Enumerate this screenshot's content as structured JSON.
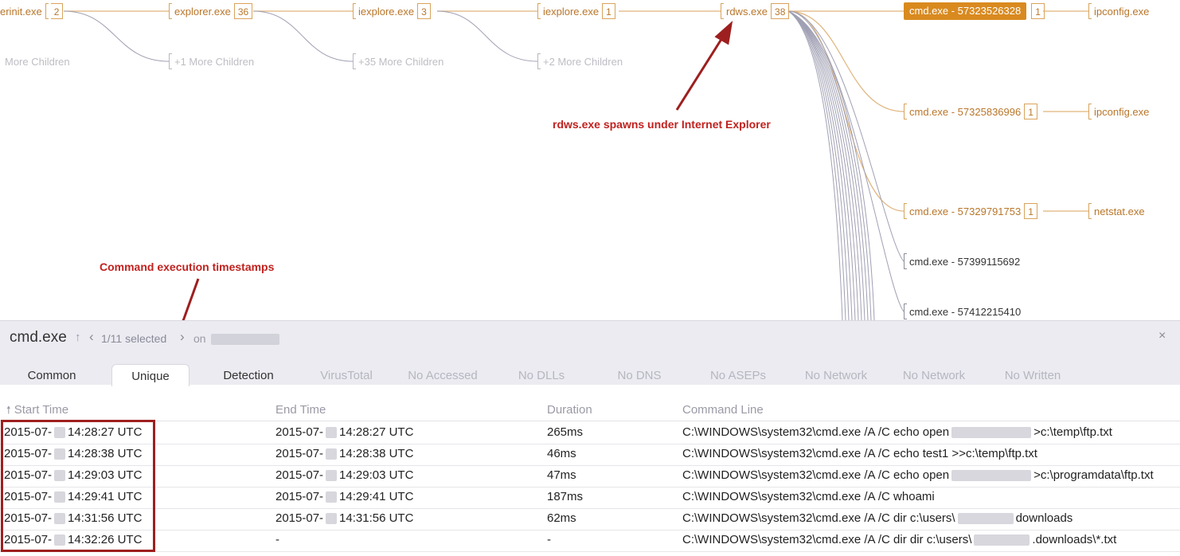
{
  "tree": {
    "nodes": [
      {
        "id": "userinit",
        "name": "erinit.exe",
        "count": "2",
        "style": "orange"
      },
      {
        "id": "explorer",
        "name": "explorer.exe",
        "count": "36",
        "style": "orange"
      },
      {
        "id": "iexplore1",
        "name": "iexplore.exe",
        "count": "3",
        "style": "orange"
      },
      {
        "id": "iexplore2",
        "name": "iexplore.exe",
        "count": "1",
        "style": "orange"
      },
      {
        "id": "rdws",
        "name": "rdws.exe",
        "count": "38",
        "style": "orange"
      },
      {
        "id": "cmd1",
        "name": "cmd.exe - 57323526328",
        "count": "1",
        "style": "selected"
      },
      {
        "id": "ipconfig1",
        "name": "ipconfig.exe",
        "count": "",
        "style": "orange"
      },
      {
        "id": "cmd2",
        "name": "cmd.exe - 57325836996",
        "count": "1",
        "style": "orange"
      },
      {
        "id": "ipconfig2",
        "name": "ipconfig.exe",
        "count": "",
        "style": "orange"
      },
      {
        "id": "cmd3",
        "name": "cmd.exe - 57329791753",
        "count": "1",
        "style": "orange"
      },
      {
        "id": "netstat",
        "name": "netstat.exe",
        "count": "",
        "style": "orange"
      },
      {
        "id": "cmd4",
        "name": "cmd.exe - 57399115692",
        "count": "",
        "style": "dark"
      },
      {
        "id": "cmd5",
        "name": "cmd.exe - 57412215410",
        "count": "",
        "style": "dark"
      },
      {
        "id": "more0",
        "name": "More Children",
        "count": "",
        "style": "gray"
      },
      {
        "id": "more1",
        "name": "+1 More Children",
        "count": "",
        "style": "gray"
      },
      {
        "id": "more2",
        "name": "+35 More Children",
        "count": "",
        "style": "gray"
      },
      {
        "id": "more3",
        "name": "+2 More Children",
        "count": "",
        "style": "gray"
      }
    ]
  },
  "annotations": {
    "rdws": "rdws.exe spawns under Internet Explorer",
    "timestamps": "Command execution timestamps"
  },
  "panel": {
    "title": "cmd.exe",
    "sort_glyph": "↑",
    "prev_glyph": "‹",
    "next_glyph": "›",
    "selected": "1/11 selected",
    "on_label": "on",
    "close_glyph": "×",
    "tabs": [
      "Common",
      "Unique",
      "Detection",
      "VirusTotal",
      "No Accessed",
      "No DLLs",
      "No DNS",
      "No ASEPs",
      "No Network",
      "No Network",
      "No Written"
    ],
    "active_tab": "Unique"
  },
  "table": {
    "columns": [
      "Start Time",
      "End Time",
      "Duration",
      "Command Line"
    ],
    "sort_indicator": "🠕",
    "rows": [
      {
        "start_a": "2015-07-",
        "start_b": "14:28:27 UTC",
        "end_a": "2015-07-",
        "end_b": "14:28:27 UTC",
        "duration": "265ms",
        "cmd_a": "C:\\WINDOWS\\system32\\cmd.exe /A /C echo open",
        "cmd_b": ">c:\\temp\\ftp.txt"
      },
      {
        "start_a": "2015-07-",
        "start_b": "14:28:38 UTC",
        "end_a": "2015-07-",
        "end_b": "14:28:38 UTC",
        "duration": "46ms",
        "cmd_a": "C:\\WINDOWS\\system32\\cmd.exe /A /C echo test1 >>c:\\temp\\ftp.txt",
        "cmd_b": ""
      },
      {
        "start_a": "2015-07-",
        "start_b": "14:29:03 UTC",
        "end_a": "2015-07-",
        "end_b": "14:29:03 UTC",
        "duration": "47ms",
        "cmd_a": "C:\\WINDOWS\\system32\\cmd.exe /A /C echo open",
        "cmd_b": ">c:\\programdata\\ftp.txt"
      },
      {
        "start_a": "2015-07-",
        "start_b": "14:29:41 UTC",
        "end_a": "2015-07-",
        "end_b": "14:29:41 UTC",
        "duration": "187ms",
        "cmd_a": "C:\\WINDOWS\\system32\\cmd.exe /A /C whoami",
        "cmd_b": ""
      },
      {
        "start_a": "2015-07-",
        "start_b": "14:31:56 UTC",
        "end_a": "2015-07-",
        "end_b": "14:31:56 UTC",
        "duration": "62ms",
        "cmd_a": "C:\\WINDOWS\\system32\\cmd.exe /A /C dir c:\\users\\",
        "cmd_b": "downloads"
      },
      {
        "start_a": "2015-07-",
        "start_b": "14:32:26 UTC",
        "end_a": "-",
        "end_b": "",
        "duration": "-",
        "cmd_a": "C:\\WINDOWS\\system32\\cmd.exe /A /C dir dir c:\\users\\",
        "cmd_b": ".downloads\\*.txt"
      }
    ]
  },
  "colors": {
    "accent_orange": "#d98a1f",
    "node_orange": "#b9762a",
    "annotation_red": "#c0221f",
    "box_red": "#9e1f1f"
  }
}
